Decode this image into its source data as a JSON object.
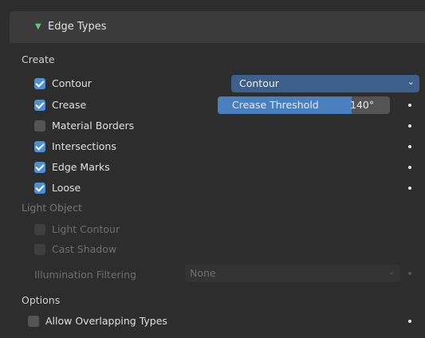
{
  "panel": {
    "title": "Edge Types"
  },
  "sections": {
    "create": "Create",
    "light_object": "Light Object",
    "options": "Options"
  },
  "create_items": [
    {
      "label": "Contour",
      "checked": true
    },
    {
      "label": "Crease",
      "checked": true
    },
    {
      "label": "Material Borders",
      "checked": false
    },
    {
      "label": "Intersections",
      "checked": true
    },
    {
      "label": "Edge Marks",
      "checked": true
    },
    {
      "label": "Loose",
      "checked": true
    }
  ],
  "contour_dropdown": {
    "value": "Contour"
  },
  "crease_threshold": {
    "label": "Crease Threshold",
    "value": "140°",
    "fraction": 0.78
  },
  "light_object_items": [
    {
      "label": "Light Contour",
      "checked": false
    },
    {
      "label": "Cast Shadow",
      "checked": false
    }
  ],
  "illumination": {
    "label": "Illumination Filtering",
    "value": "None"
  },
  "options_items": [
    {
      "label": "Allow Overlapping Types",
      "checked": false
    }
  ],
  "colors": {
    "accent": "#4a90d9",
    "dropdown": "#3d5f8c",
    "header_triangle": "#65c86a"
  },
  "icons": {
    "header": "triangle-down-icon",
    "dropdown": "chevron-down-icon",
    "decorate": "keyframe-dot-icon"
  }
}
